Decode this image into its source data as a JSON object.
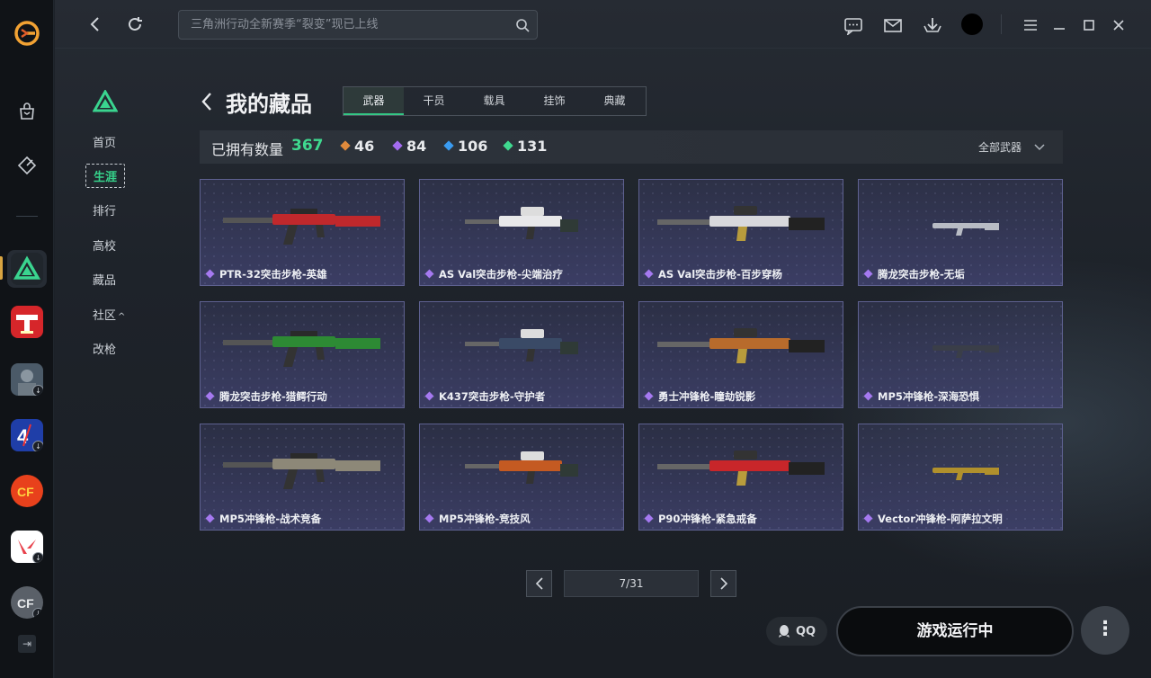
{
  "app": {
    "search_placeholder": "三角洲行动全新赛季“裂变”现已上线"
  },
  "subnav": {
    "items": [
      {
        "label": "首页"
      },
      {
        "label": "生涯"
      },
      {
        "label": "排行"
      },
      {
        "label": "高校"
      },
      {
        "label": "藏品"
      },
      {
        "label": "社区"
      },
      {
        "label": "改枪"
      }
    ],
    "community_caret": "^"
  },
  "page": {
    "title": "我的藏品",
    "tabs": [
      {
        "label": "武器",
        "active": true
      },
      {
        "label": "干员"
      },
      {
        "label": "载具"
      },
      {
        "label": "挂饰"
      },
      {
        "label": "典藏"
      }
    ]
  },
  "stats": {
    "label": "已拥有数量",
    "total": "367",
    "rarity_counts": [
      {
        "value": "46",
        "color": "#e08a3c"
      },
      {
        "value": "84",
        "color": "#a46cf0"
      },
      {
        "value": "106",
        "color": "#3a9bf0"
      },
      {
        "value": "131",
        "color": "#3fd98f"
      }
    ],
    "filter_label": "全部武器"
  },
  "cards": [
    {
      "name": "PTR-32突击步枪-英雄",
      "accent": "#c0282c"
    },
    {
      "name": "AS Val突击步枪-尖端治疗",
      "accent": "#e8e8ea"
    },
    {
      "name": "AS Val突击步枪-百步穿杨",
      "accent": "#d8d8dc"
    },
    {
      "name": "腾龙突击步枪-无垢",
      "accent": "#b8bcc4"
    },
    {
      "name": "腾龙突击步枪-猎鳄行动",
      "accent": "#2d8a34"
    },
    {
      "name": "K437突击步枪-守护者",
      "accent": "#3a4a66"
    },
    {
      "name": "勇士冲锋枪-瞳劫锐影",
      "accent": "#b86b2c"
    },
    {
      "name": "MP5冲锋枪-深海恐惧",
      "accent": "#3a3e48"
    },
    {
      "name": "MP5冲锋枪-战术竞备",
      "accent": "#8d8878"
    },
    {
      "name": "MP5冲锋枪-竞技风",
      "accent": "#c45a22"
    },
    {
      "name": "P90冲锋枪-紧急戒备",
      "accent": "#c8262a"
    },
    {
      "name": "Vector冲锋枪-阿萨拉文明",
      "accent": "#b0902c"
    }
  ],
  "pagination": {
    "current": "7/31",
    "prev": "<",
    "next": ">"
  },
  "actions": {
    "qq_label": "QQ",
    "run_label": "游戏运行中",
    "more_label": "⋮"
  }
}
